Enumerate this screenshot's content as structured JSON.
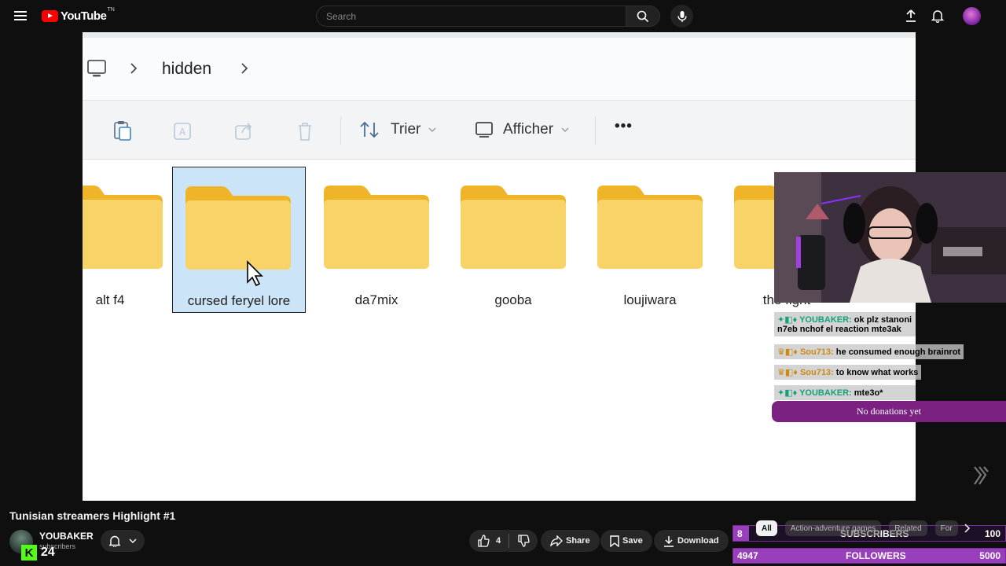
{
  "header": {
    "logo_text": "YouTube",
    "logo_tm": "TN",
    "search_placeholder": "Search"
  },
  "explorer": {
    "breadcrumb": [
      "hidden"
    ],
    "toolbar": {
      "sort_label": "Trier",
      "view_label": "Afficher",
      "more_label": "•••"
    },
    "folders": [
      {
        "label": "alt f4",
        "selected": false
      },
      {
        "label": "cursed feryel lore",
        "selected": true
      },
      {
        "label": "da7mix",
        "selected": false
      },
      {
        "label": "gooba",
        "selected": false
      },
      {
        "label": "loujiwara",
        "selected": false
      },
      {
        "label": "the fight",
        "selected": false
      }
    ]
  },
  "chat": [
    {
      "user": "YOUBAKER:",
      "message": "ok plz stanoni n7eb nchof el reaction mte3ak",
      "badge_color": "#14a07a"
    },
    {
      "user": "Sou713:",
      "message": "he consumed enough brainrot",
      "badge_color": "#cc8a10"
    },
    {
      "user": "Sou713:",
      "message": "to know what works",
      "badge_color": "#cc8a10"
    },
    {
      "user": "YOUBAKER:",
      "message": "mte3o*",
      "badge_color": "#14a07a"
    }
  ],
  "donations_text": "No donations yet",
  "video": {
    "title": "Tunisian streamers Highlight #1",
    "channel_name": "YOUBAKER",
    "channel_subs": "subscribers",
    "kick_count": "24",
    "like_count": "4",
    "share_label": "Share",
    "save_label": "Save",
    "download_label": "Download"
  },
  "chips": [
    "All",
    "Action-adventure games",
    "Related",
    "For"
  ],
  "goals": {
    "subscribers": {
      "current": "8",
      "label": "SUBSCRIBERS",
      "target": "100"
    },
    "followers": {
      "current": "4947",
      "label": "FOLLOWERS",
      "target": "5000"
    }
  },
  "colors": {
    "brand_red": "#ff0000",
    "goal_purple": "#9a3fbc",
    "donation_purple": "#7b2182",
    "selection_blue": "#cce4f7"
  }
}
